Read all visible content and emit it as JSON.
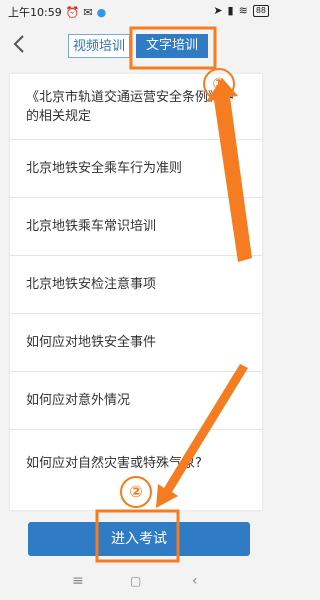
{
  "status_bar": {
    "time": "上午10:59",
    "battery": "88"
  },
  "header": {
    "tabs": [
      {
        "label": "视频培训",
        "active": false
      },
      {
        "label": "文字培训",
        "active": true
      }
    ]
  },
  "list": {
    "items": [
      {
        "label": "《北京市轨道交通运营安全条例》中的相关规定"
      },
      {
        "label": "北京地铁安全乘车行为准则"
      },
      {
        "label": "北京地铁乘车常识培训"
      },
      {
        "label": "北京地铁安检注意事项"
      },
      {
        "label": "如何应对地铁安全事件"
      },
      {
        "label": "如何应对意外情况"
      },
      {
        "label": "如何应对自然灾害或特殊气象?"
      }
    ]
  },
  "enter_button": {
    "label": "进入考试"
  },
  "annotations": [
    {
      "number": "①"
    },
    {
      "number": "②"
    }
  ],
  "colors": {
    "accent": "#2f7cc4",
    "annotation": "#f57c20"
  }
}
